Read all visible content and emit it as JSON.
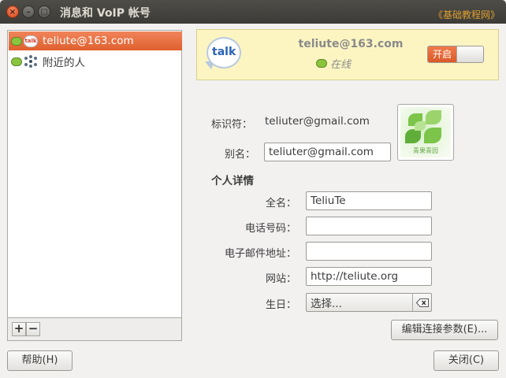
{
  "window": {
    "title": "消息和 VoIP 帐号",
    "close_glyph": "×",
    "min_glyph": "–",
    "max_glyph": "□"
  },
  "watermark": "《基础教程网》",
  "accounts": [
    {
      "label": "teliute@163.com",
      "selected": true,
      "icons": [
        "chat-bubble-icon",
        "talk-icon"
      ]
    },
    {
      "label": "附近的人",
      "selected": false,
      "icons": [
        "chat-bubble-icon",
        "people-nearby-icon"
      ]
    }
  ],
  "list_tools": {
    "add": "+",
    "remove": "−"
  },
  "banner": {
    "logo_text": "talk",
    "email": "teliute@163.com",
    "status": "在线",
    "toggle_on_label": "开启",
    "toggle_state": "on"
  },
  "form": {
    "identifier_label": "标识符：",
    "identifier_value": "teliuter@gmail.com",
    "alias_label": "别名：",
    "alias_value": "teliuter@gmail.com",
    "section_title": "个人详情",
    "fullname_label": "全名：",
    "fullname_value": "TeliuTe",
    "phone_label": "电话号码：",
    "phone_value": "",
    "email_label": "电子邮件地址：",
    "email_value": "",
    "website_label": "网站：",
    "website_value": "http://teliute.org",
    "birthday_label": "生日：",
    "birthday_value": "选择..."
  },
  "avatar": {
    "caption": "青果青园"
  },
  "buttons": {
    "edit_params": "编辑连接参数(E)...",
    "help": "帮助(H)",
    "close": "关闭(C)"
  },
  "colors": {
    "selection": "#e8693a",
    "banner_bg": "#fcf5c2",
    "title_bar": "#3c3b37",
    "online": "#8bc43f"
  }
}
